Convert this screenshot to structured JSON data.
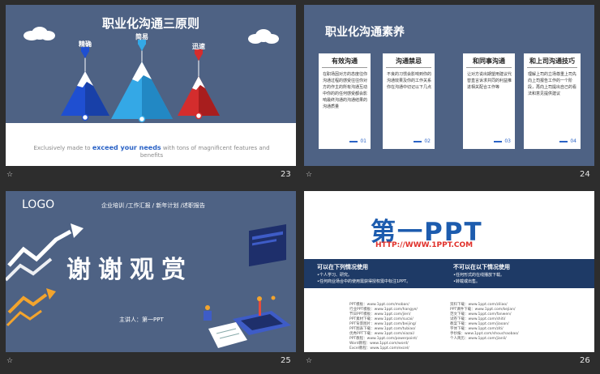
{
  "slides": [
    {
      "number": "23",
      "title": "职业化沟通三原则",
      "principles": [
        "精确",
        "简易",
        "迅速"
      ],
      "caption_pre": "Exclusively made to ",
      "caption_em": "exceed your needs",
      "caption_post": " with tons of magnificent features  and benefits",
      "colors": {
        "left": "#1f4fd1",
        "center": "#34a8e6",
        "right": "#d42d2d"
      }
    },
    {
      "number": "24",
      "title": "职业化沟通素养",
      "cards": [
        {
          "heading": "有效沟通",
          "body": "在职场因对方的态度往你沟通过程的感受往往你对方的作主的所有沟通互动中你的的任何感受都会影响最终沟通的沟通结果的沟通质量",
          "num": "01"
        },
        {
          "heading": "沟通禁忌",
          "body": "不良的习惯会影响到你的沟通效果及你的工作关系你在沟通中切记以下几点",
          "num": "02"
        },
        {
          "heading": "和同事沟通",
          "body": "让对方说出期望用建议代替直言诉求共同的利益推进相关配合工作等",
          "num": "03"
        },
        {
          "heading": "和上司沟通技巧",
          "body": "理解上司的立场尊重上司先向上司报告工作的一个阶段，再向上司提出自己的看法和意见提供建议",
          "num": "04"
        }
      ]
    },
    {
      "number": "25",
      "logo": "LOGO",
      "menu": "企业培训  /工作汇报  / 新年计划  /述职报告",
      "thanks": "谢谢观赏",
      "speaker": "主讲人：第一PPT"
    },
    {
      "number": "26",
      "brand": "第一PPT",
      "url": "HTTP://WWW.1PPT.COM",
      "allowed_title": "可以在下列情况使用",
      "allowed_items": [
        "•个人学习、研究。",
        "•任何商业场合中的使用需获得授权需中标注1PPT。"
      ],
      "forbidden_title": "不可以在以下情况使用",
      "forbidden_items": [
        "•任何形式的在线播放下载。",
        "•转载或出售。"
      ],
      "links_left": [
        "PPT模板：www.1ppt.com/moban/",
        "行业PPT模板：www.1ppt.com/hangye/",
        "节日PPT模板：www.1ppt.com/jieri/",
        "PPT素材下载：www.1ppt.com/sucai/",
        "PPT背景图片：www.1ppt.com/beijing/",
        "PPT图表下载：www.1ppt.com/tubiao/",
        "优秀PPT下载：www.1ppt.com/xiazai/",
        "PPT教程：www.1ppt.com/powerpoint/",
        "Word教程：www.1ppt.com/word/",
        "Excel教程：www.1ppt.com/excel/"
      ],
      "links_right": [
        "资料下载：www.1ppt.com/ziliao/",
        "PPT课件下载：www.1ppt.com/kejian/",
        "范文下载：www.1ppt.com/fanwen/",
        "试卷下载：www.1ppt.com/shiti/",
        "教案下载：www.1ppt.com/jiaoan/",
        "字体下载：www.1ppt.com/ziti/",
        "手抄报：www.1ppt.com/shouchaobao/",
        "个人简历：www.1ppt.com/jianli/"
      ]
    }
  ],
  "corner_mark": "☆"
}
